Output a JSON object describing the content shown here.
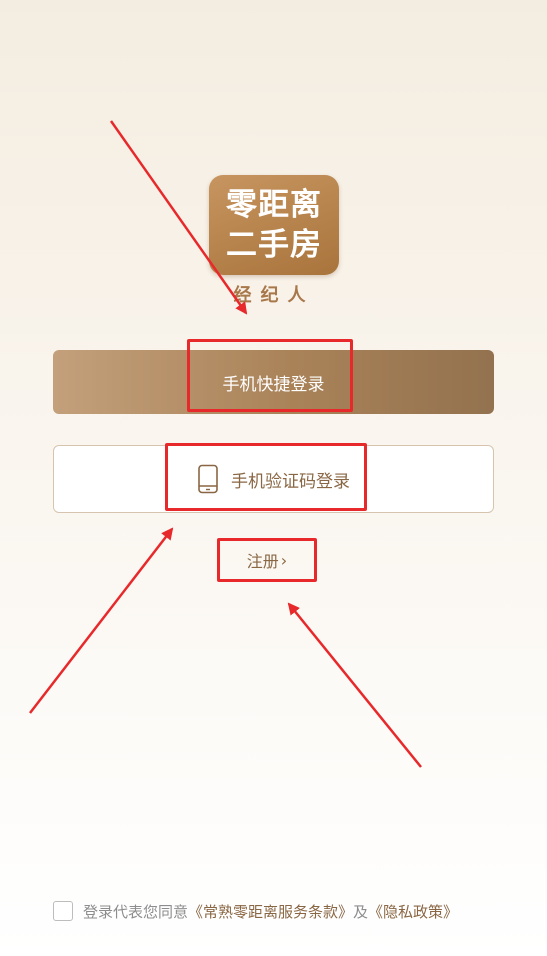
{
  "logo": {
    "line1": "零距离",
    "line2": "二手房",
    "subtitle": "经纪人"
  },
  "buttons": {
    "quick_login": "手机快捷登录",
    "code_login": "手机验证码登录",
    "register": "注册",
    "register_chevron": "›"
  },
  "agreement": {
    "prefix": "登录代表您同意",
    "terms_link": "《常熟零距离服务条款》",
    "and": "及",
    "privacy_link": "《隐私政策》",
    "checked": false
  },
  "icons": {
    "phone": "phone-icon",
    "chevron": "chevron-right-icon",
    "checkbox": "checkbox-icon"
  },
  "colors": {
    "brand_brown": "#a9743c",
    "text_brown": "#8a6744",
    "annotation_red": "#e8292b"
  }
}
